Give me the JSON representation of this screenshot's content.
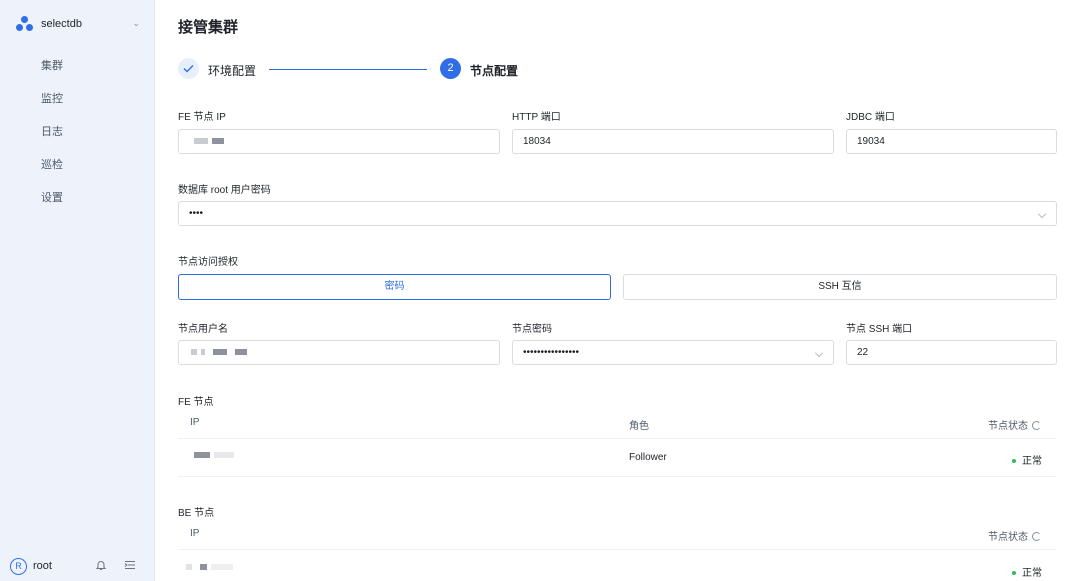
{
  "sidebar": {
    "brand": "selectdb",
    "nav": [
      "集群",
      "监控",
      "日志",
      "巡检",
      "设置"
    ],
    "user_initial": "R",
    "user": "root",
    "icons": [
      "bell-icon",
      "menu-collapse-icon"
    ]
  },
  "page": {
    "title": "接管集群",
    "steps": [
      {
        "label": "环境配置",
        "status": "done"
      },
      {
        "number": "2",
        "label": "节点配置",
        "status": "active"
      }
    ]
  },
  "form": {
    "fe_ip_label": "FE 节点 IP",
    "http_port_label": "HTTP 端口",
    "http_port_value": "18034",
    "jdbc_port_label": "JDBC 端口",
    "jdbc_port_value": "19034",
    "db_password_label": "数据库 root 用户密码",
    "db_password_value": "••••",
    "auth_label": "节点访问授权",
    "auth_options": [
      "密码",
      "SSH 互信"
    ],
    "node_user_label": "节点用户名",
    "node_password_label": "节点密码",
    "node_password_value": "••••••••••••••••",
    "ssh_port_label": "节点 SSH 端口",
    "ssh_port_value": "22"
  },
  "fe_table": {
    "title": "FE 节点",
    "headers": [
      "IP",
      "角色",
      "节点状态"
    ],
    "rows": [
      {
        "role": "Follower",
        "status": "正常"
      }
    ]
  },
  "be_table": {
    "title": "BE 节点",
    "headers": [
      "IP",
      "节点状态"
    ],
    "rows": [
      {
        "status": "正常"
      }
    ]
  },
  "colors": {
    "accent": "#2f6ee5",
    "success": "#2fbf5a",
    "sidebar_bg": "#eef3fb"
  }
}
